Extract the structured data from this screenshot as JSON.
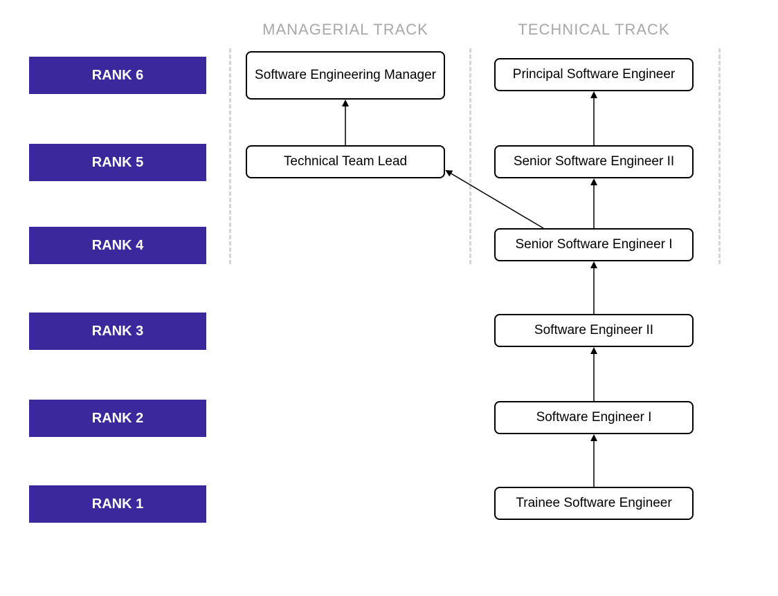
{
  "colors": {
    "rank_bg": "#3b289c",
    "rank_fg": "#ffffff",
    "header_fg": "#a8a8a8",
    "divider": "#d5d5d5"
  },
  "tracks": {
    "managerial": {
      "header": "MANAGERIAL TRACK"
    },
    "technical": {
      "header": "TECHNICAL TRACK"
    }
  },
  "ranks": {
    "r6": "RANK 6",
    "r5": "RANK 5",
    "r4": "RANK 4",
    "r3": "RANK 3",
    "r2": "RANK 2",
    "r1": "RANK 1"
  },
  "roles": {
    "managerial": {
      "r6": "Software Engineering Manager",
      "r5": "Technical Team Lead"
    },
    "technical": {
      "r6": "Principal Software Engineer",
      "r5": "Senior Software Engineer II",
      "r4": "Senior Software Engineer I",
      "r3": "Software Engineer II",
      "r2": "Software Engineer I",
      "r1": "Trainee Software Engineer"
    }
  },
  "arrows": [
    {
      "from": "technical.r1",
      "to": "technical.r2"
    },
    {
      "from": "technical.r2",
      "to": "technical.r3"
    },
    {
      "from": "technical.r3",
      "to": "technical.r4"
    },
    {
      "from": "technical.r4",
      "to": "technical.r5"
    },
    {
      "from": "technical.r5",
      "to": "technical.r6"
    },
    {
      "from": "managerial.r5",
      "to": "managerial.r6"
    },
    {
      "from": "technical.r4",
      "to": "managerial.r5"
    }
  ]
}
